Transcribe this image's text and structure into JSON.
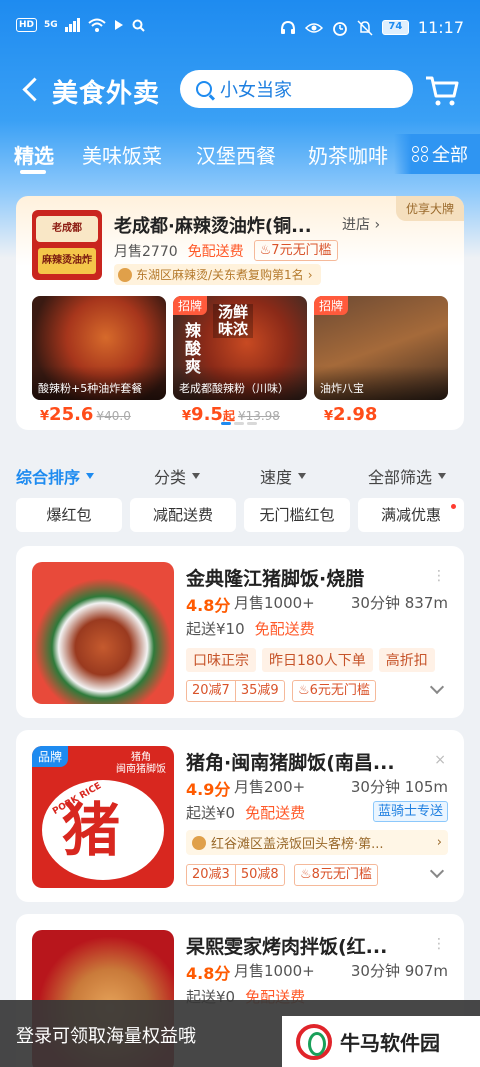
{
  "status_bar": {
    "left_icons": [
      "HD",
      "5G",
      "signal-icon",
      "wifi-icon",
      "nfc-icon",
      "search-icon"
    ],
    "right_icons": [
      "headset-icon",
      "eye-icon",
      "alarm-icon",
      "mute-icon"
    ],
    "battery": "74",
    "time": "11:17"
  },
  "header": {
    "title": "美食外卖",
    "search_value": "小女当家"
  },
  "tabs": {
    "items": [
      {
        "label": "精选",
        "active": true
      },
      {
        "label": "美味饭菜",
        "active": false
      },
      {
        "label": "汉堡西餐",
        "active": false
      },
      {
        "label": "奶茶咖啡",
        "active": false
      }
    ],
    "all_label": "全部"
  },
  "featured": {
    "badge": "优享大牌",
    "logo_top": "老成都",
    "logo_bottom": "麻辣烫油炸",
    "name": "老成都·麻辣烫油炸(铜...",
    "enter_label": "进店",
    "monthly_sales": "月售2770",
    "free_delivery": "免配送费",
    "threshold_tag": "7元无门槛",
    "rank_text": "东湖区麻辣烫/关东煮复购第1名",
    "dishes": [
      {
        "label": "酸辣粉+5种油炸套餐",
        "badge": "",
        "overlay": "",
        "overlay2": "",
        "price": "25.6",
        "price_suffix": "",
        "old_price": "¥40.0"
      },
      {
        "label": "老成都酸辣粉（川味）",
        "badge": "招牌",
        "overlay": "辣酸爽",
        "overlay2": "汤鲜味浓",
        "price": "9.5",
        "price_suffix": "起",
        "old_price": "¥13.98"
      },
      {
        "label": "油炸八宝",
        "badge": "招牌",
        "overlay": "",
        "overlay2": "",
        "price": "2.98",
        "price_suffix": "",
        "old_price": ""
      }
    ]
  },
  "sort_bar": {
    "items": [
      "综合排序",
      "分类",
      "速度",
      "全部筛选"
    ]
  },
  "filters": [
    "爆红包",
    "减配送费",
    "无门槛红包",
    "满减优惠"
  ],
  "shops": [
    {
      "name": "金典隆江猪脚饭·烧腊",
      "rating": "4.8分",
      "sales": "月售1000+",
      "distance": "30分钟 837m",
      "min_order": "起送¥10",
      "delivery": "免配送费",
      "tags": [
        "口味正宗",
        "昨日180人下单",
        "高折扣"
      ],
      "promos": [
        "20减7",
        "35减9"
      ],
      "promo2": "6元无门槛"
    },
    {
      "brand_badge": "品牌",
      "img_char": "猪角",
      "img_brand": "猪角",
      "img_brand_sub": "闽南猪脚饭",
      "img_ribbon": "PORK RICE",
      "name": "猪角·闽南猪脚饭(南昌...",
      "rating": "4.9分",
      "sales": "月售200+",
      "distance": "30分钟 105m",
      "min_order": "起送¥0",
      "delivery": "免配送费",
      "rider": "蓝骑士专送",
      "rank_text": "红谷滩区盖浇饭回头客榜·第...",
      "promos": [
        "20减3",
        "50减8"
      ],
      "promo2": "8元无门槛"
    },
    {
      "name": "杲熙雯家烤肉拌饭(红...",
      "rating": "4.8分",
      "sales": "月售1000+",
      "distance": "30分钟 907m",
      "min_order": "起送¥0",
      "delivery": "免配送费"
    }
  ],
  "login_banner": {
    "text": "登录可领取海量权益哦"
  },
  "watermark": {
    "text": "牛马软件园"
  }
}
